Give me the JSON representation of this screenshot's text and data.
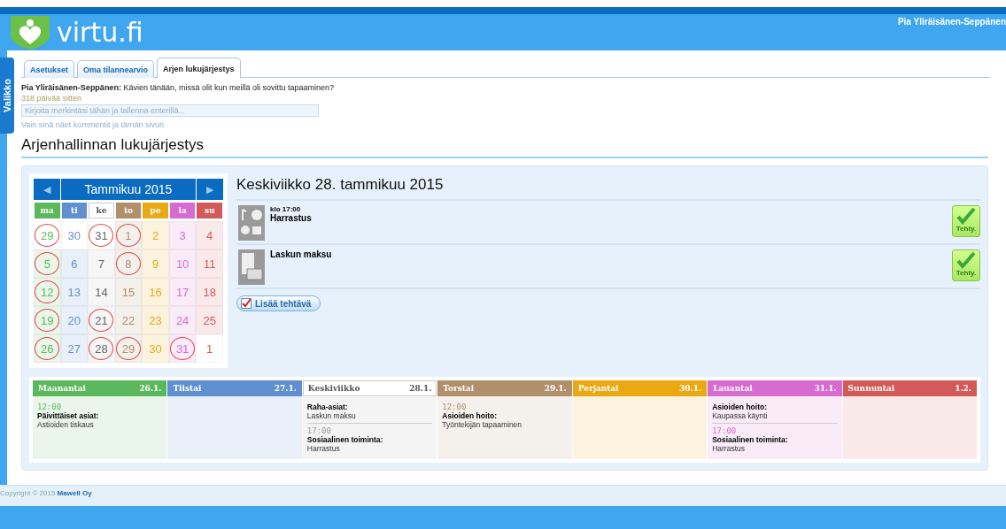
{
  "header": {
    "logo_text": "virtu.fi",
    "user_name": "Pia Yliräisänen-Seppänen"
  },
  "side_tab": {
    "label": "Valikko"
  },
  "tabs": [
    {
      "label": "Asetukset",
      "selected": false
    },
    {
      "label": "Oma tilannearvio",
      "selected": false
    },
    {
      "label": "Arjen lukujärjestys",
      "selected": true
    }
  ],
  "comment": {
    "author": "Pia Yliräisänen-Seppänen:",
    "text": "Kävien tänään, missä olit kun meillä oli sovittu tapaaminen?",
    "age": "318 päivää sitten",
    "placeholder": "Kirjoita merkintäsi tähän ja tallenna enterillä...",
    "privacy_note": "Vain sinä näet kommentit ja tämän sivun"
  },
  "page_title": "Arjenhallinnan lukujärjestys",
  "calendar": {
    "month": "Tammikuu 2015",
    "prev": "◀",
    "next": "▶",
    "weekdays": [
      {
        "label": "ma",
        "color": "#5cb85c",
        "selected": false
      },
      {
        "label": "ti",
        "color": "#6190d0",
        "selected": false
      },
      {
        "label": "ke",
        "color": "#555555",
        "selected": true
      },
      {
        "label": "to",
        "color": "#b08f6a",
        "selected": false
      },
      {
        "label": "pe",
        "color": "#eaa812",
        "selected": false
      },
      {
        "label": "la",
        "color": "#d86bd0",
        "selected": false
      },
      {
        "label": "su",
        "color": "#d45a5a",
        "selected": false
      }
    ],
    "weeks": [
      [
        {
          "day": "29",
          "circled": true,
          "outside": true
        },
        {
          "day": "30",
          "circled": false,
          "outside": true
        },
        {
          "day": "31",
          "circled": true,
          "outside": true
        },
        {
          "day": "1",
          "circled": true,
          "outside": false
        },
        {
          "day": "2",
          "circled": false,
          "outside": false
        },
        {
          "day": "3",
          "circled": false,
          "outside": false
        },
        {
          "day": "4",
          "circled": false,
          "outside": false
        }
      ],
      [
        {
          "day": "5",
          "circled": true,
          "outside": false
        },
        {
          "day": "6",
          "circled": false,
          "outside": false
        },
        {
          "day": "7",
          "circled": false,
          "outside": false
        },
        {
          "day": "8",
          "circled": true,
          "outside": false
        },
        {
          "day": "9",
          "circled": false,
          "outside": false
        },
        {
          "day": "10",
          "circled": false,
          "outside": false
        },
        {
          "day": "11",
          "circled": false,
          "outside": false
        }
      ],
      [
        {
          "day": "12",
          "circled": true,
          "outside": false
        },
        {
          "day": "13",
          "circled": false,
          "outside": false
        },
        {
          "day": "14",
          "circled": false,
          "outside": false
        },
        {
          "day": "15",
          "circled": false,
          "outside": false
        },
        {
          "day": "16",
          "circled": false,
          "outside": false
        },
        {
          "day": "17",
          "circled": false,
          "outside": false
        },
        {
          "day": "18",
          "circled": false,
          "outside": false
        }
      ],
      [
        {
          "day": "19",
          "circled": true,
          "outside": false
        },
        {
          "day": "20",
          "circled": false,
          "outside": false
        },
        {
          "day": "21",
          "circled": true,
          "outside": false
        },
        {
          "day": "22",
          "circled": false,
          "outside": false
        },
        {
          "day": "23",
          "circled": false,
          "outside": false
        },
        {
          "day": "24",
          "circled": false,
          "outside": false
        },
        {
          "day": "25",
          "circled": false,
          "outside": false
        }
      ],
      [
        {
          "day": "26",
          "circled": true,
          "outside": false
        },
        {
          "day": "27",
          "circled": false,
          "outside": false
        },
        {
          "day": "28",
          "circled": true,
          "outside": false
        },
        {
          "day": "29",
          "circled": true,
          "outside": false
        },
        {
          "day": "30",
          "circled": false,
          "outside": false
        },
        {
          "day": "31",
          "circled": true,
          "outside": false
        },
        {
          "day": "1",
          "circled": false,
          "outside": true
        }
      ]
    ]
  },
  "day_view": {
    "title": "Keskiviikko  28. tammikuu 2015",
    "tasks": [
      {
        "kind": "hobby",
        "time": "klo 17:00",
        "name": "Harrastus",
        "done_label": "Tehty."
      },
      {
        "kind": "bill",
        "name": "Laskun maksu",
        "done_label": "Tehty."
      }
    ],
    "add_button": "Lisää tehtävä"
  },
  "week": [
    {
      "name": "Maanantai",
      "date": "26.1.",
      "color": "#5cb85c",
      "selected": false,
      "entries": [
        {
          "time": "12:00",
          "category": "Päivittäiset asiat:",
          "task": "Astioiden tiskaus"
        }
      ]
    },
    {
      "name": "Tiistai",
      "date": "27.1.",
      "color": "#6190d0",
      "selected": false
    },
    {
      "name": "Keskiviikko",
      "date": "28.1.",
      "color": "#555555",
      "selected": true,
      "entries": [
        {
          "category": "Raha-asiat:",
          "task": "Laskun maksu"
        },
        {
          "time": "17:00",
          "category": "Sosiaalinen toiminta:",
          "task": "Harrastus"
        }
      ]
    },
    {
      "name": "Torstai",
      "date": "29.1.",
      "color": "#b08f6a",
      "selected": false,
      "entries": [
        {
          "time": "12:00",
          "category": "Asioiden hoito:",
          "task": "Työntekijän tapaaminen"
        }
      ]
    },
    {
      "name": "Perjantai",
      "date": "30.1.",
      "color": "#eaa812",
      "selected": false
    },
    {
      "name": "Lauantai",
      "date": "31.1.",
      "color": "#d86bd0",
      "selected": false,
      "entries": [
        {
          "category": "Asioiden hoito:",
          "task": "Kaupassa käynti"
        },
        {
          "time": "17:00",
          "category": "Sosiaalinen toiminta:",
          "task": "Harrastus"
        }
      ]
    },
    {
      "name": "Sunnuntai",
      "date": "1.2.",
      "color": "#d45a5a",
      "selected": false
    }
  ],
  "footer": {
    "text": "Copyright © 2015",
    "company": "Mawell Oy"
  }
}
